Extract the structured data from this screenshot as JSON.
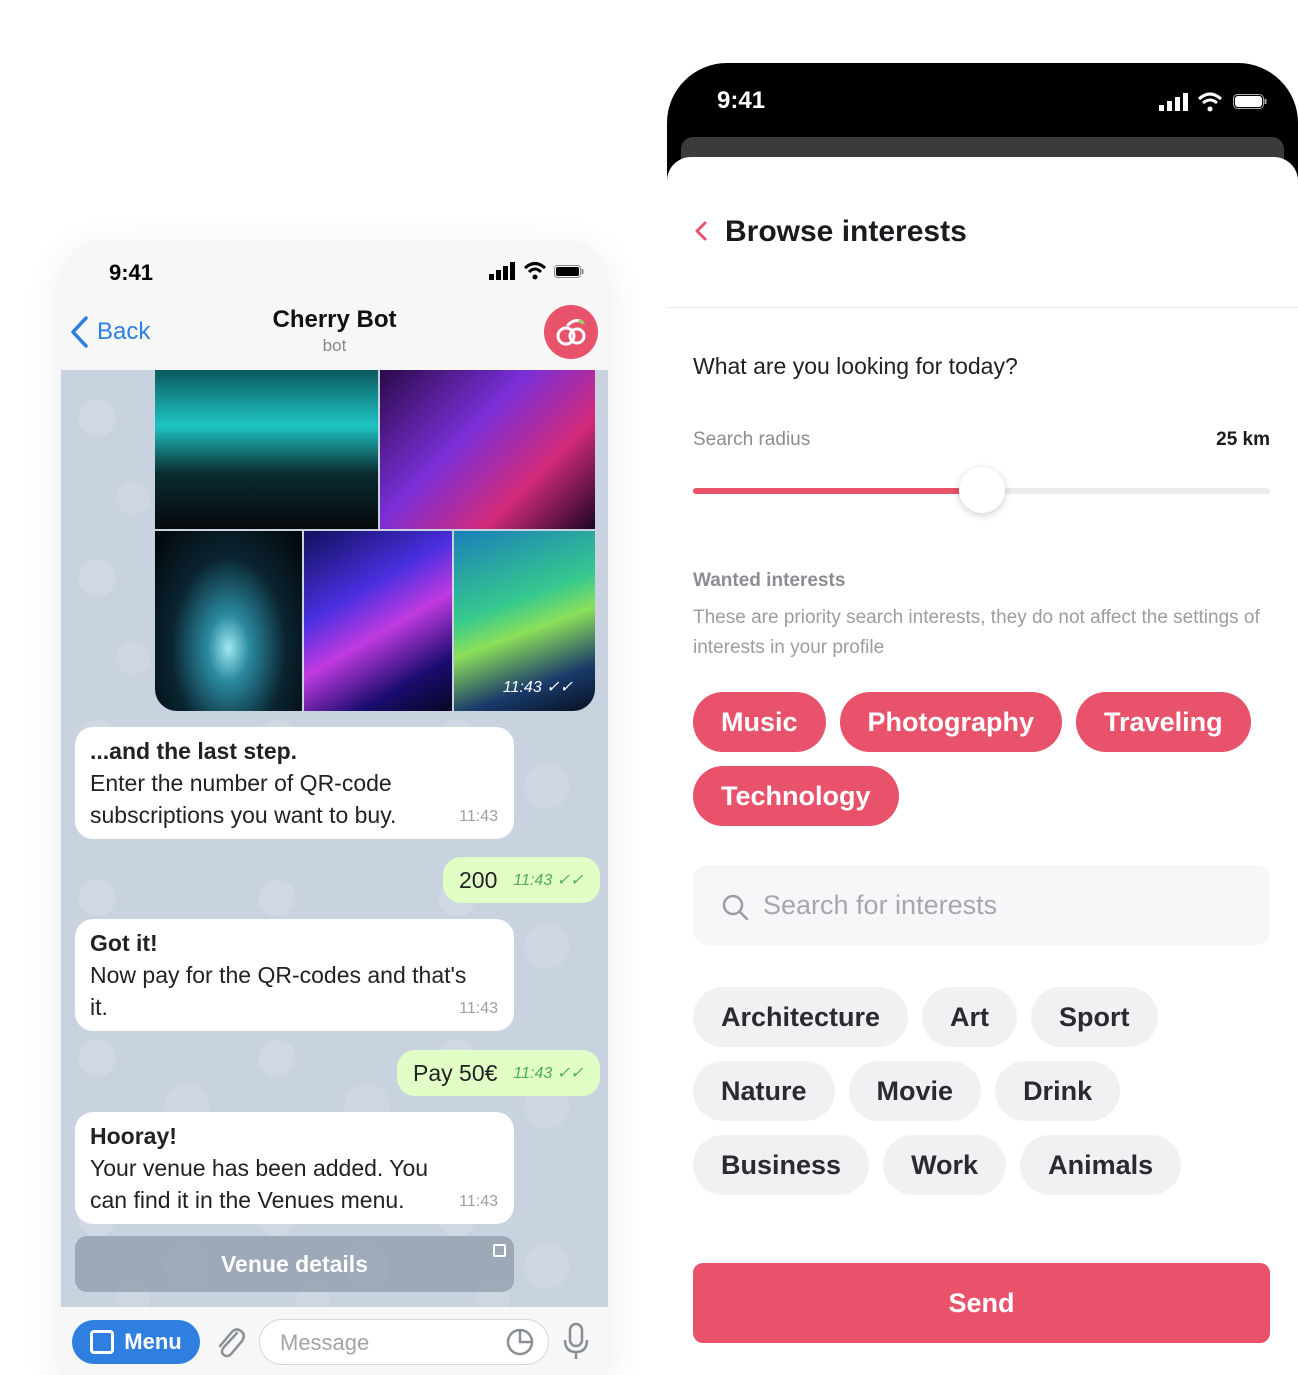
{
  "telegram": {
    "status_time": "9:41",
    "back_label": "Back",
    "chat_title": "Cherry Bot",
    "chat_subtitle": "bot",
    "photo_time": "11:43",
    "messages": [
      {
        "title": "...and the last step.",
        "body": "Enter the number of QR-code subscriptions you want to buy.",
        "time": "11:43"
      },
      {
        "title": "Got it!",
        "body": "Now pay for the QR-codes and that's it.",
        "time": "11:43"
      },
      {
        "title": "Hooray!",
        "body": "Your venue has been added. You can find it in the Venues menu.",
        "time": "11:43"
      }
    ],
    "outgoing": [
      {
        "text": "200",
        "time": "11:43"
      },
      {
        "text": "Pay 50€",
        "time": "11:43"
      }
    ],
    "venue_button": "Venue details",
    "menu_label": "Menu",
    "message_placeholder": "Message",
    "accent_color": "#2f7fe0",
    "outgoing_bubble_color": "#e1fec6"
  },
  "interests": {
    "status_time": "9:41",
    "title": "Browse interests",
    "question": "What are you looking for today?",
    "radius_label": "Search radius",
    "radius_value": "25 km",
    "radius_fraction": 0.5,
    "wanted_label": "Wanted interests",
    "wanted_desc": "These are priority search interests, they do not affect the settings of interests in your profile",
    "selected": [
      "Music",
      "Photography",
      "Traveling",
      "Technology"
    ],
    "search_placeholder": "Search for interests",
    "options": [
      "Architecture",
      "Art",
      "Sport",
      "Nature",
      "Movie",
      "Drink",
      "Business",
      "Work",
      "Animals"
    ],
    "send_label": "Send",
    "accent_color": "#e8526b"
  }
}
